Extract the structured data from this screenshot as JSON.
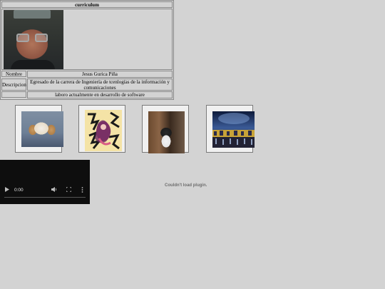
{
  "curriculum": {
    "title": "curriculum",
    "rows": [
      {
        "label": "Nombre",
        "value": "Jesus Gurica Piña"
      },
      {
        "label": "Descripcion",
        "value": "Egresado de la carrera de Ingeniería de tcenlogías de la información y comunicaciones"
      },
      {
        "label": "",
        "value": "laboro actualmente en desarrollo de software"
      }
    ]
  },
  "gallery": {
    "images": [
      {
        "subject": "puppy"
      },
      {
        "subject": "anime-art"
      },
      {
        "subject": "cat"
      },
      {
        "subject": "night-city"
      }
    ]
  },
  "video": {
    "time": "0:00",
    "icons": [
      "play-icon",
      "volume-icon",
      "fullscreen-icon",
      "more-options-icon"
    ]
  },
  "plugin": {
    "message": "Couldn't load plugin."
  }
}
